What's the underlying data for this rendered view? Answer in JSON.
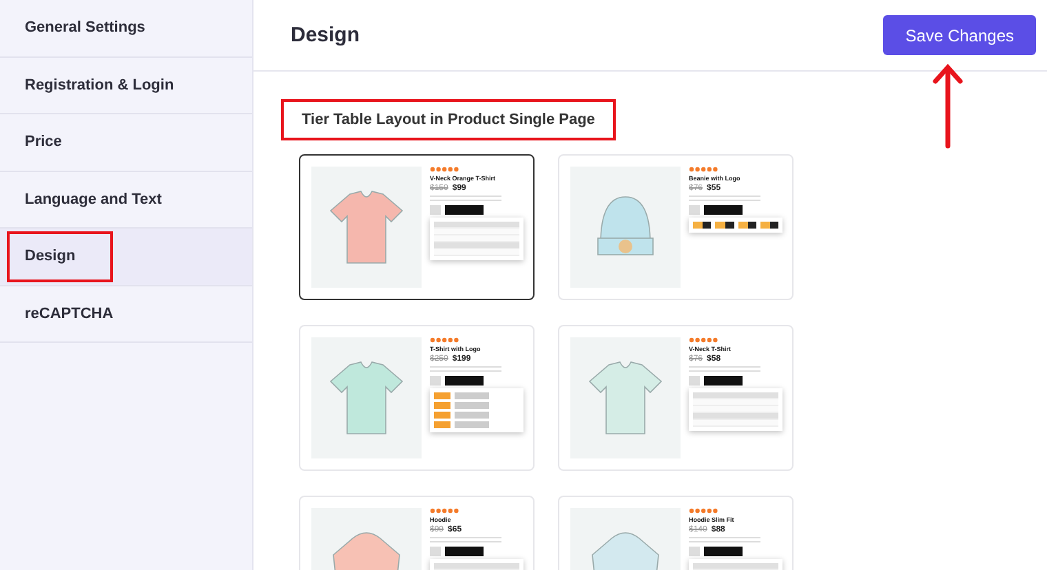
{
  "sidebar": {
    "items": [
      {
        "label": "General Settings",
        "selected": false
      },
      {
        "label": "Registration & Login",
        "selected": false
      },
      {
        "label": "Price",
        "selected": false
      },
      {
        "label": "Language and Text",
        "selected": false
      },
      {
        "label": "Design",
        "selected": true
      },
      {
        "label": "reCAPTCHA",
        "selected": false
      }
    ]
  },
  "header": {
    "title": "Design",
    "save_button": "Save Changes"
  },
  "section": {
    "title": "Tier Table Layout in Product Single Page"
  },
  "layouts": [
    {
      "kind": "table",
      "image": {
        "kind": "shirt"
      },
      "color": "#f5b7ad",
      "name": "V-Neck Orange T-Shirt",
      "old_price": "$150",
      "price": "$99",
      "selected": true
    },
    {
      "kind": "chips",
      "image": {
        "kind": "beanie"
      },
      "color": "#bfe3ec",
      "name": "Beanie with Logo",
      "old_price": "$76",
      "price": "$55",
      "selected": false
    },
    {
      "kind": "list",
      "image": {
        "kind": "shirt"
      },
      "color": "#bfe8dc",
      "name": "T-Shirt with Logo",
      "old_price": "$250",
      "price": "$199",
      "selected": false
    },
    {
      "kind": "table",
      "image": {
        "kind": "shirt"
      },
      "color": "#d5ede6",
      "name": "V-Neck T-Shirt",
      "old_price": "$76",
      "price": "$58",
      "selected": false
    },
    {
      "kind": "table",
      "image": {
        "kind": "hoodie"
      },
      "color": "#f7c1b4",
      "name": "Hoodie",
      "old_price": "$99",
      "price": "$65",
      "selected": false
    },
    {
      "kind": "table",
      "image": {
        "kind": "hoodie"
      },
      "color": "#d3e9ef",
      "name": "Hoodie Slim Fit",
      "old_price": "$140",
      "price": "$88",
      "selected": false
    }
  ]
}
